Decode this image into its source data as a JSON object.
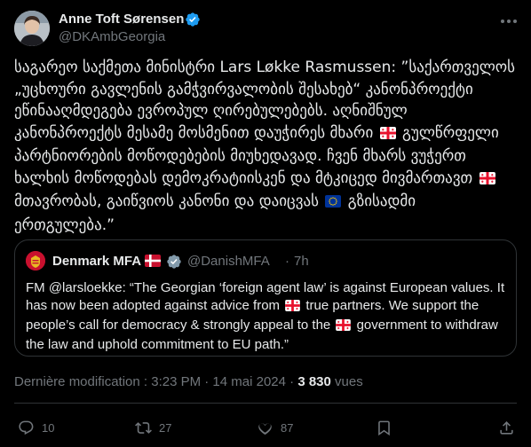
{
  "author": {
    "name": "Anne Toft Sørensen",
    "handle": "@DKAmbGeorgia",
    "verified": true
  },
  "tweet": {
    "text_parts": [
      "საგარეო საქმეთა მინისტრი Lars Løkke Rasmussen: ”საქართველოს „უცხოური გავლენის გამჭვირვალობის შესახებ“ კანონპროექტი ეწინააღმდეგება ევროპულ ღირებულებებს. აღნიშნულ კანონპროექტს მესამე მოსმენით დაუჭირეს მხარი ",
      " გულწრფელი პარტნიორების მოწოდებების მიუხედავად. ჩვენ მხარს ვუჭერთ ხალხის მოწოდებას დემოკრატიისკენ და მტკიცედ მივმართავთ ",
      "მთავრობას, გაიწვიოს კანონი და დაიცვას ",
      " გზისადმი ერთგულება.”"
    ],
    "flags": [
      "flag-georgia",
      "flag-georgia",
      "flag-eu"
    ]
  },
  "quote": {
    "name": "Denmark MFA",
    "handle": "@DanishMFA",
    "separator": "·",
    "time": "7h",
    "text_parts": [
      "FM @larsloekke: “The Georgian ‘foreign agent law’ is against European values. It has now been adopted against advice from ",
      " true partners. We support the people’s call for democracy & strongly appeal to the ",
      " government to withdraw the law and uphold commitment to EU path.”"
    ]
  },
  "meta": {
    "edited_label": "Dernière modification : 3:23 PM · 14 mai 2024 · ",
    "views_count": "3 830",
    "views_label": " vues"
  },
  "actions": {
    "replies": "10",
    "reposts": "27",
    "likes": "87"
  },
  "colors": {
    "background": "#000000",
    "text": "#e7e9ea",
    "secondary": "#71767b",
    "border": "#2f3336",
    "verified_blue": "#1d9bf0",
    "gov_gray": "#829aab"
  }
}
